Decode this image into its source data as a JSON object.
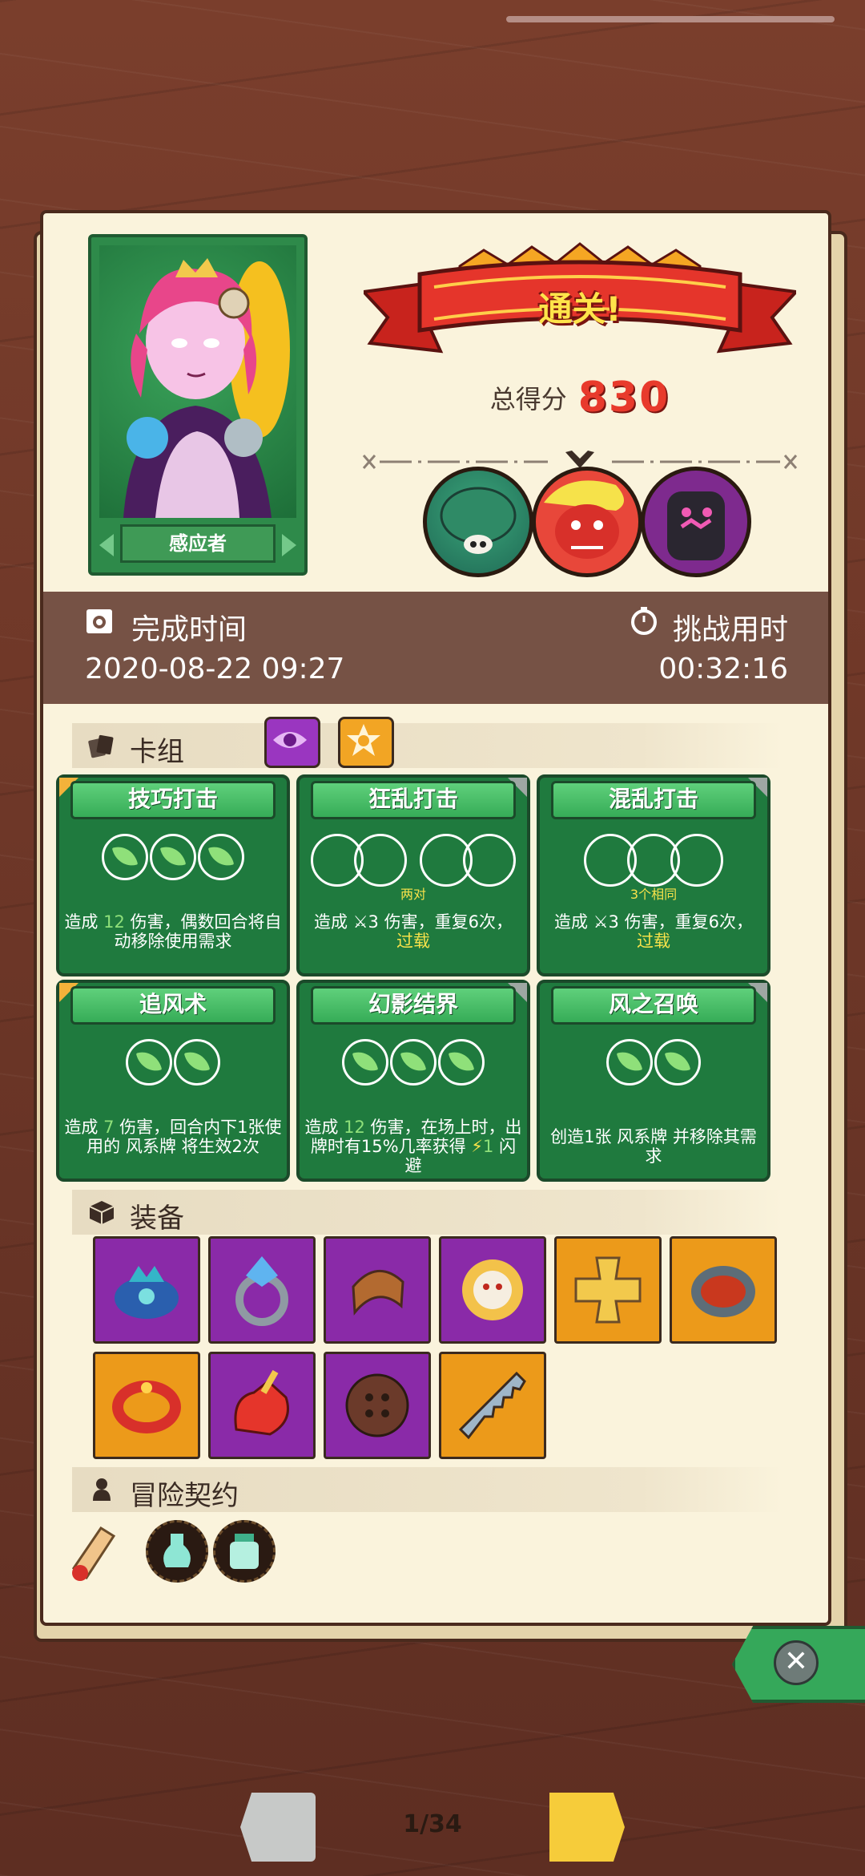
{
  "hero": {
    "name": "感应者"
  },
  "result": {
    "banner": "通关!",
    "score_label": "总得分",
    "score_value": "830"
  },
  "times": {
    "complete_label": "完成时间",
    "complete_value": "2020-08-22 09:27",
    "challenge_label": "挑战用时",
    "challenge_value": "00:32:16"
  },
  "deck": {
    "title": "卡组",
    "cards": [
      {
        "title": "技巧打击",
        "orbs": 3,
        "sub": "",
        "desc_pre": "造成 ",
        "num": "12",
        "desc_post": " 伤害，偶数回合将自动移除使用需求"
      },
      {
        "title": "狂乱打击",
        "orbs": 0,
        "sub": "两对",
        "desc_pre": "造成 ",
        "num": "3",
        "desc_post": " 伤害，重复6次，",
        "extra": "过载"
      },
      {
        "title": "混乱打击",
        "orbs": 0,
        "sub": "3个相同",
        "desc_pre": "造成 ",
        "num": "3",
        "desc_post": " 伤害，重复6次，",
        "extra": "过载"
      },
      {
        "title": "追风术",
        "orbs": 2,
        "sub": "",
        "desc_pre": "造成 ",
        "num": "7",
        "desc_post": " 伤害，回合内下1张使用的 风系牌 将生效2次"
      },
      {
        "title": "幻影结界",
        "orbs": 3,
        "sub": "",
        "desc_pre": "造成 ",
        "num": "12",
        "desc_post": " 伤害，在场上时，出牌时有15%几率获得 ",
        "extra": "1",
        "desc_end": " 闪避"
      },
      {
        "title": "风之召唤",
        "orbs": 2,
        "sub": "",
        "desc_pre": "创造1张 ",
        "num": "",
        "desc_post": "风系牌 并移除其需求"
      }
    ]
  },
  "equipment": {
    "title": "装备",
    "items": [
      {
        "name": "crown-amulet",
        "rarity": "purple"
      },
      {
        "name": "gem-ring",
        "rarity": "purple"
      },
      {
        "name": "leather-bracer",
        "rarity": "purple"
      },
      {
        "name": "sun-mask",
        "rarity": "purple"
      },
      {
        "name": "golden-cross",
        "rarity": "orange"
      },
      {
        "name": "ember-shield",
        "rarity": "orange"
      },
      {
        "name": "ruby-bracelet",
        "rarity": "orange"
      },
      {
        "name": "fire-gauntlet",
        "rarity": "purple"
      },
      {
        "name": "wooden-button",
        "rarity": "purple"
      },
      {
        "name": "steel-saw",
        "rarity": "orange"
      }
    ]
  },
  "contract": {
    "title": "冒险契约"
  },
  "pager": {
    "text": "1/34"
  },
  "colors": {
    "accent_green": "#35a85a",
    "score_red": "#e83a2c",
    "purple_rarity": "#8a2aa8",
    "orange_rarity": "#ec9a1a"
  }
}
